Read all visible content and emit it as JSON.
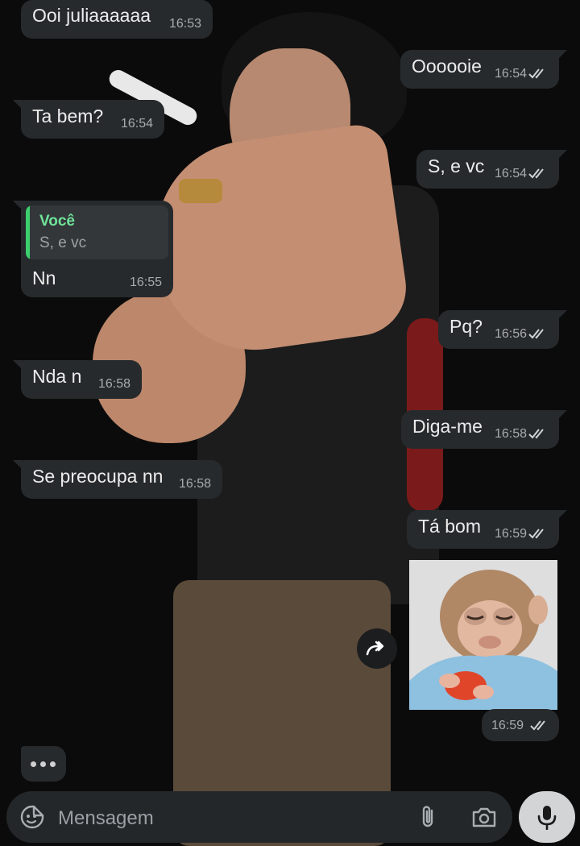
{
  "messages": [
    {
      "dir": "in",
      "text": "Ooi juliaaaaaa",
      "time": "16:53"
    },
    {
      "dir": "out",
      "text": "Oooooie",
      "time": "16:54"
    },
    {
      "dir": "in",
      "text": "Ta bem?",
      "time": "16:54"
    },
    {
      "dir": "out",
      "text": "S, e vc",
      "time": "16:54"
    },
    {
      "dir": "in",
      "text": "Nn",
      "time": "16:55",
      "quote": {
        "author": "Você",
        "text": "S, e vc"
      }
    },
    {
      "dir": "out",
      "text": "Pq?",
      "time": "16:56"
    },
    {
      "dir": "in",
      "text": "Nda n",
      "time": "16:58"
    },
    {
      "dir": "out",
      "text": "Diga-me",
      "time": "16:58"
    },
    {
      "dir": "in",
      "text": "Se preocupa nn",
      "time": "16:58"
    },
    {
      "dir": "out",
      "text": "Tá bom",
      "time": "16:59"
    },
    {
      "dir": "out",
      "type": "sticker",
      "subject": "baby-monkey-eating",
      "time": "16:59"
    }
  ],
  "composer": {
    "placeholder": "Mensagem"
  },
  "colors": {
    "bubble": "#272a2d",
    "quote_accent": "#3ccf6e",
    "ticks": "#d0d3d6",
    "mic_button": "#d2d4d6"
  }
}
